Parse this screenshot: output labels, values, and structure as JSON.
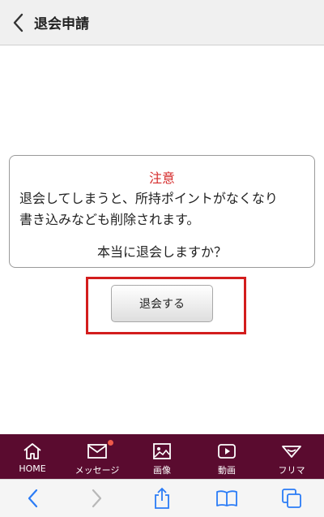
{
  "header": {
    "title": "退会申請"
  },
  "notice": {
    "title": "注意",
    "message": "退会してしまうと、所持ポイントがなくなり\n書き込みなども削除されます。",
    "question": "本当に退会しますか？"
  },
  "withdraw_button": {
    "label": "退会する"
  },
  "tabs": [
    {
      "label": "HOME",
      "icon": "home-icon"
    },
    {
      "label": "メッセージ",
      "icon": "mail-icon",
      "badge": true
    },
    {
      "label": "画像",
      "icon": "image-icon"
    },
    {
      "label": "動画",
      "icon": "play-icon"
    },
    {
      "label": "フリマ",
      "icon": "ribbon-icon"
    }
  ],
  "colors": {
    "header_bg": "#f0f0f0",
    "tabbar_bg": "#5a0b2f",
    "notice_title": "#d52b2b",
    "highlight": "#d31d1d",
    "safari_blue": "#2b7cf6"
  },
  "safari_toolbar": [
    "back-icon",
    "forward-icon",
    "share-icon",
    "bookmarks-icon",
    "tabs-icon"
  ]
}
